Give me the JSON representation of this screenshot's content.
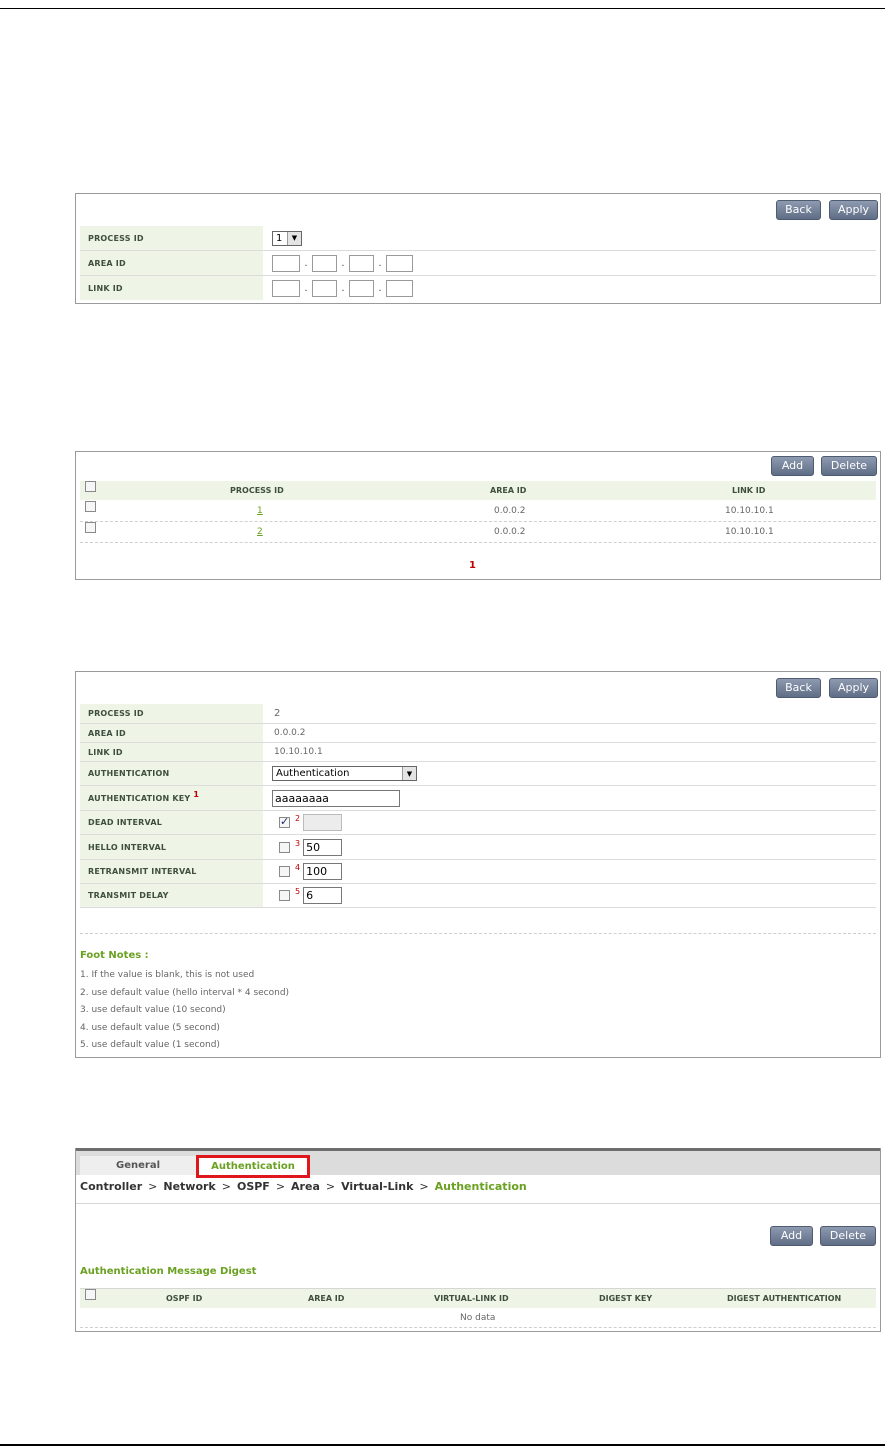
{
  "panel1": {
    "back": "Back",
    "apply": "Apply",
    "rows": [
      {
        "label": "PROCESS ID",
        "value": "1"
      },
      {
        "label": "AREA ID",
        "dot": "."
      },
      {
        "label": "LINK ID",
        "dot": "."
      }
    ]
  },
  "panel2": {
    "add": "Add",
    "delete": "Delete",
    "headers": [
      "PROCESS ID",
      "AREA ID",
      "LINK ID"
    ],
    "rows": [
      {
        "process_id": "1",
        "area_id": "0.0.0.2",
        "link_id": "10.10.10.1"
      },
      {
        "process_id": "2",
        "area_id": "0.0.0.2",
        "link_id": "10.10.10.1"
      }
    ],
    "page": "1"
  },
  "panel3": {
    "back": "Back",
    "apply": "Apply",
    "rows": [
      {
        "label": "PROCESS ID",
        "value": "2"
      },
      {
        "label": "AREA ID",
        "value": "0.0.0.2"
      },
      {
        "label": "LINK ID",
        "value": "10.10.10.1"
      },
      {
        "label": "AUTHENTICATION",
        "value": "Authentication"
      },
      {
        "label": "AUTHENTICATION KEY",
        "sup": "1",
        "value": "aaaaaaaa"
      },
      {
        "label": "DEAD INTERVAL",
        "sup": "2",
        "value": "",
        "checked": true
      },
      {
        "label": "HELLO INTERVAL",
        "sup": "3",
        "value": "50",
        "checked": false
      },
      {
        "label": "RETRANSMIT INTERVAL",
        "sup": "4",
        "value": "100",
        "checked": false
      },
      {
        "label": "TRANSMIT DELAY",
        "sup": "5",
        "value": "6",
        "checked": false
      }
    ],
    "notes_title": "Foot Notes :",
    "notes": [
      "1. If the value is blank, this is not used",
      "2. use default value (hello interval * 4 second)",
      "3. use default value (10 second)",
      "4. use default value (5 second)",
      "5. use default value (1 second)"
    ]
  },
  "panel4": {
    "tabs": [
      "General",
      "Authentication"
    ],
    "breadcrumb": [
      "Controller",
      "Network",
      "OSPF",
      "Area",
      "Virtual-Link",
      "Authentication"
    ],
    "breadcrumb_sep": ">",
    "add": "Add",
    "delete": "Delete",
    "section_title": "Authentication Message Digest",
    "headers": [
      "OSPF ID",
      "AREA ID",
      "VIRTUAL-LINK ID",
      "DIGEST KEY",
      "DIGEST AUTHENTICATION"
    ],
    "empty": "No data"
  },
  "colors": {
    "accent_green": "#6aa121",
    "highlight_red": "#e0161d"
  }
}
